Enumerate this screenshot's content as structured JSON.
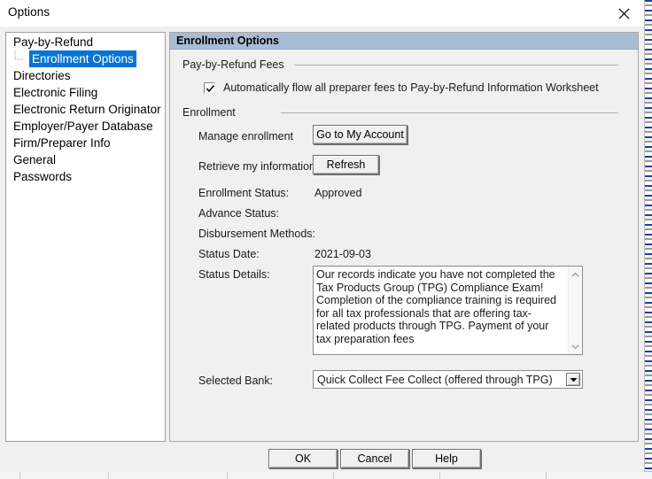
{
  "window": {
    "title": "Options",
    "close_icon": "close-icon"
  },
  "sidebar": {
    "items": [
      {
        "label": "Pay-by-Refund",
        "level": 0,
        "selected": false
      },
      {
        "label": "Enrollment Options",
        "level": 1,
        "selected": true
      },
      {
        "label": "Directories",
        "level": 0,
        "selected": false
      },
      {
        "label": "Electronic Filing",
        "level": 0,
        "selected": false
      },
      {
        "label": "Electronic Return Originator Info",
        "level": 0,
        "selected": false
      },
      {
        "label": "Employer/Payer Database",
        "level": 0,
        "selected": false
      },
      {
        "label": "Firm/Preparer Info",
        "level": 0,
        "selected": false
      },
      {
        "label": "General",
        "level": 0,
        "selected": false
      },
      {
        "label": "Passwords",
        "level": 0,
        "selected": false
      }
    ]
  },
  "panel": {
    "header": "Enrollment Options",
    "groups": {
      "fees_label": "Pay-by-Refund Fees",
      "enrollment_label": "Enrollment"
    },
    "checkbox": {
      "label": "Automatically flow all preparer fees to Pay-by-Refund Information Worksheet",
      "checked": true
    },
    "rows": {
      "manage_enrollment_label": "Manage enrollment",
      "manage_enrollment_button": "Go to My Account",
      "retrieve_info_label": "Retrieve my information",
      "retrieve_info_button": "Refresh",
      "enrollment_status_label": "Enrollment Status:",
      "enrollment_status_value": "Approved",
      "advance_status_label": "Advance Status:",
      "advance_status_value": "",
      "disbursement_methods_label": "Disbursement Methods:",
      "disbursement_methods_value": "",
      "status_date_label": "Status Date:",
      "status_date_value": "2021-09-03",
      "status_details_label": "Status Details:",
      "status_details_value": "Our records indicate you have not completed the Tax Products Group (TPG) Compliance Exam! Completion of the compliance training is required for all tax professionals that are offering tax-related products through TPG. Payment of your tax preparation fees",
      "selected_bank_label": "Selected Bank:",
      "selected_bank_value": "Quick Collect Fee Collect (offered through TPG)"
    }
  },
  "footer": {
    "ok": "OK",
    "cancel": "Cancel",
    "help": "Help"
  },
  "colors": {
    "panel_header": "#a8bdd4",
    "selection": "#0a74d4",
    "dialog_face": "#f0f0f0"
  }
}
